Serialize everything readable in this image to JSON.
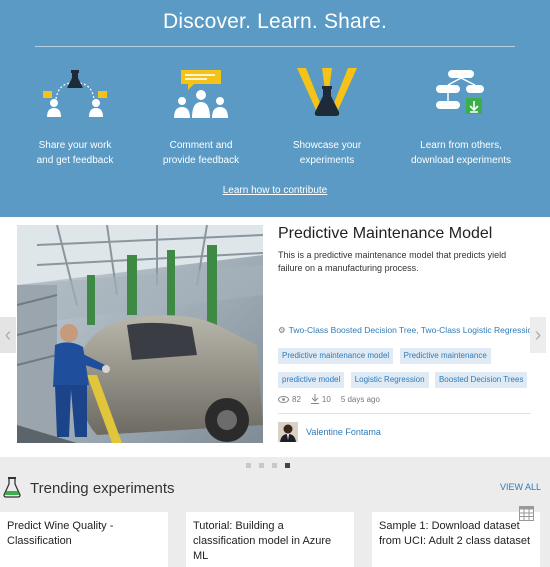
{
  "banner": {
    "title": "Discover. Learn. Share.",
    "features": [
      {
        "line1": "Share your work",
        "line2": "and get feedback",
        "icon": "share-network-icon"
      },
      {
        "line1": "Comment and",
        "line2": "provide feedback",
        "icon": "comment-group-icon"
      },
      {
        "line1": "Showcase your",
        "line2": "experiments",
        "icon": "flask-spotlight-icon"
      },
      {
        "line1": "Learn from others,",
        "line2": "download experiments",
        "icon": "workflow-download-icon"
      }
    ],
    "contribute_link": "Learn how to contribute",
    "colors": {
      "background": "#5a9ac4",
      "accent": "#f5c218"
    }
  },
  "featured": {
    "title": "Predictive Maintenance Model",
    "description": "This is a predictive maintenance model that predicts yield failure on a manufacturing process.",
    "algorithms": "Two-Class Boosted Decision Tree, Two-Class Logistic Regression...",
    "tags": [
      "Predictive maintenance model",
      "Predictive maintenance",
      "predictive model",
      "Logistic Regression",
      "Boosted Decision Trees"
    ],
    "views": "82",
    "downloads": "10",
    "age": "5 days ago",
    "author": "Valentine Fontama",
    "prev_arrow": "‹",
    "next_arrow": "›",
    "page_count": 4,
    "active_page": 4
  },
  "trending": {
    "title": "Trending experiments",
    "view_all": "VIEW ALL",
    "cards": [
      {
        "title": "Predict Wine Quality - Classification"
      },
      {
        "title": "Tutorial: Building a classification model in Azure ML"
      },
      {
        "title": "Sample 1: Download dataset from UCI: Adult 2 class dataset"
      }
    ]
  },
  "colors": {
    "link": "#2e7bb8",
    "tag_bg": "#dfeaf4",
    "page_bg": "#ececec"
  }
}
